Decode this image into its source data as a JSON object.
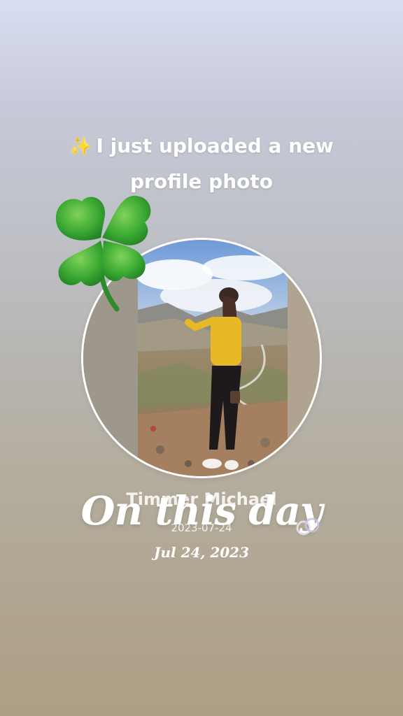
{
  "headline": {
    "icon": "sparkles-icon",
    "line1": "I just uploaded a new",
    "line2": "profile photo"
  },
  "sticker": {
    "icon": "four-leaf-clover-icon"
  },
  "photo": {
    "description_icon": "profile-photo"
  },
  "author": {
    "name": "Timmer Michael",
    "date": "2023-07-24"
  },
  "memory": {
    "title": "On this day",
    "date": "Jul 24, 2023"
  },
  "colors": {
    "clover": "#3aa832",
    "sparkle": "#f5c842",
    "text": "#ffffff"
  }
}
